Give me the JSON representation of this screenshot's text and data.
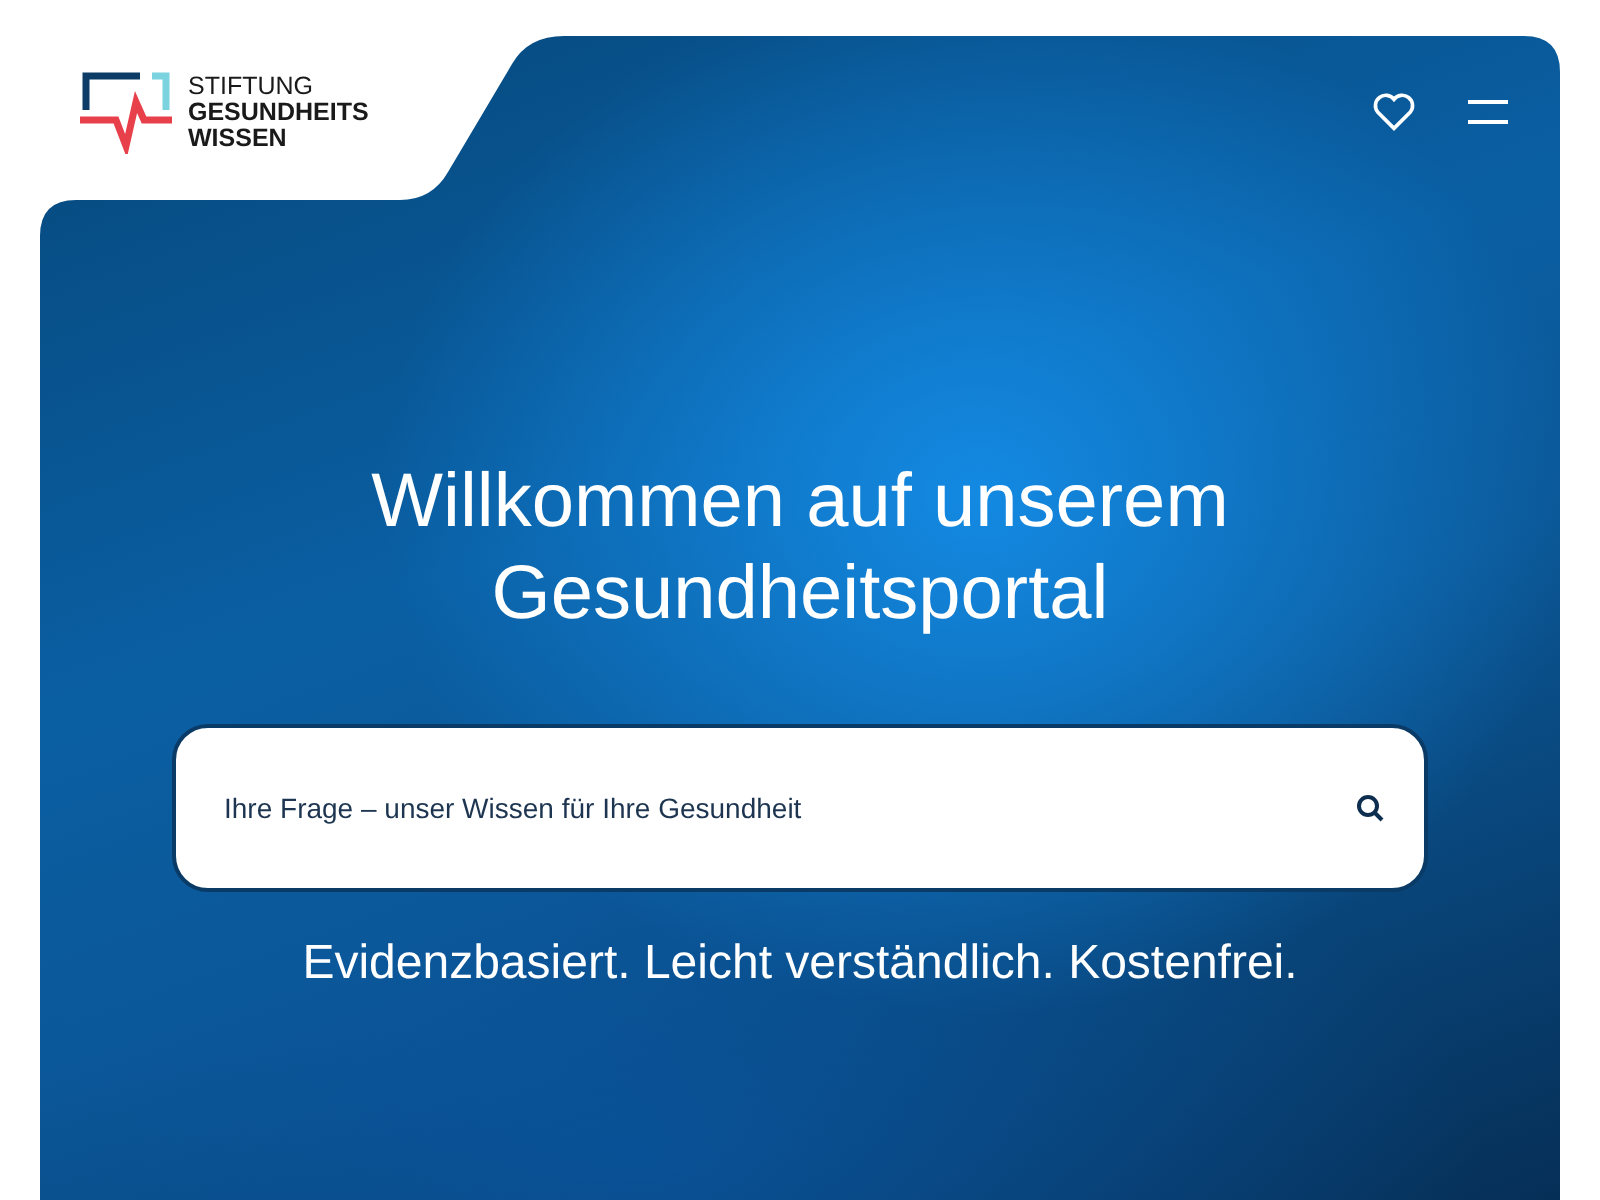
{
  "logo": {
    "lines": [
      "STIFTUNG",
      "GESUNDHEITS",
      "WISSEN"
    ]
  },
  "hero": {
    "title_lines": [
      "Willkommen auf unserem",
      "Gesundheitsportal"
    ],
    "search": {
      "placeholder": "Ihre Frage – unser Wissen für Ihre Gesundheit"
    },
    "tagline": "Evidenzbasiert. Leicht verständlich. Kostenfrei."
  }
}
